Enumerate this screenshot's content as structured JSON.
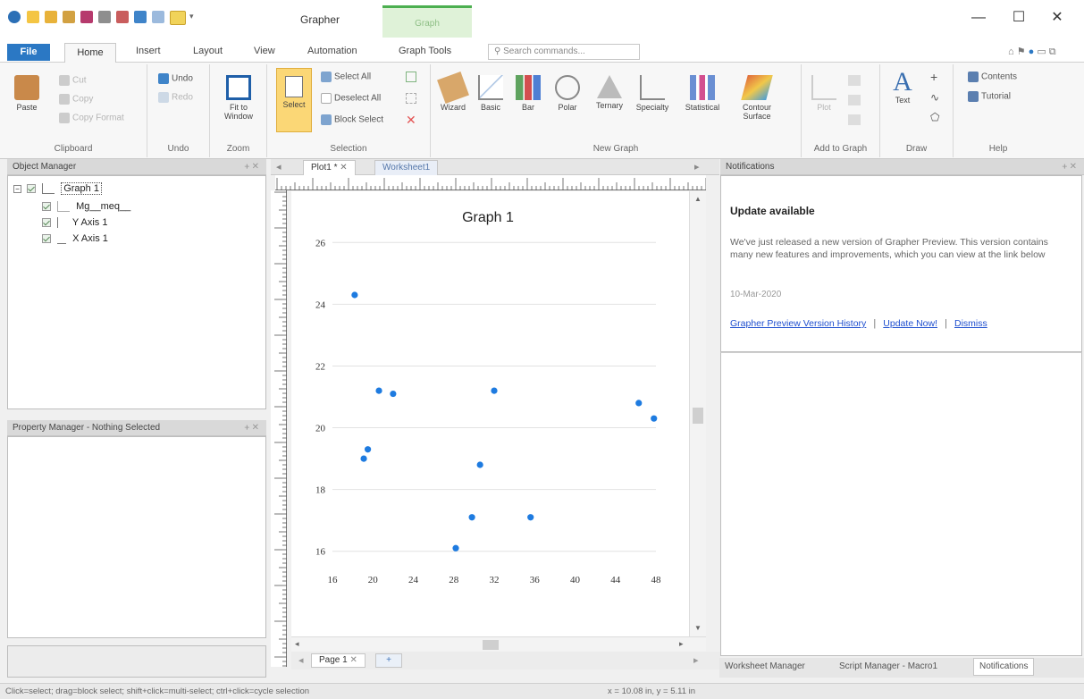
{
  "window": {
    "title": "Grapher",
    "context_tab": "Graph",
    "minimize": "—",
    "maximize": "☐",
    "close": "✕"
  },
  "ribbon_tabs": [
    "File",
    "Home",
    "Insert",
    "Layout",
    "View",
    "Automation",
    "Graph Tools"
  ],
  "search": {
    "placeholder": "Search commands..."
  },
  "ribbon": {
    "clipboard": {
      "label": "Clipboard",
      "paste": "Paste",
      "cut": "Cut",
      "copy": "Copy",
      "copy_format": "Copy Format"
    },
    "undo": {
      "label": "Undo",
      "undo": "Undo",
      "redo": "Redo"
    },
    "zoom": {
      "label": "Zoom",
      "fit": "Fit to Window"
    },
    "selection": {
      "label": "Selection",
      "select": "Select",
      "select_all": "Select All",
      "deselect_all": "Deselect All",
      "block_select": "Block Select"
    },
    "new_graph": {
      "label": "New Graph",
      "items": [
        "Wizard",
        "Basic",
        "Bar",
        "Polar",
        "Ternary",
        "Specialty",
        "Statistical",
        "Contour Surface"
      ]
    },
    "add_to_graph": {
      "label": "Add to Graph",
      "plot": "Plot"
    },
    "draw": {
      "label": "Draw",
      "text": "Text"
    },
    "help": {
      "label": "Help",
      "contents": "Contents",
      "tutorial": "Tutorial"
    }
  },
  "object_manager": {
    "title": "Object Manager",
    "items": [
      "Graph 1",
      "Mg__meq__",
      "Y Axis 1",
      "X Axis 1"
    ]
  },
  "property_manager": {
    "title": "Property Manager - Nothing Selected"
  },
  "doc_tabs": [
    "Plot1 *",
    "Worksheet1"
  ],
  "page_tab": "Page 1",
  "notifications": {
    "panel_title": "Notifications",
    "title": "Update available",
    "body": "We've just released a new version of Grapher Preview. This version contains many new features and improvements, which you can view at the link below",
    "date": "10-Mar-2020",
    "link_history": "Grapher Preview Version History",
    "link_update": "Update Now!",
    "link_dismiss": "Dismiss",
    "sep": "|"
  },
  "bottom_tabs": [
    "Worksheet Manager",
    "Script Manager - Macro1",
    "Notifications"
  ],
  "status": {
    "hint": "Click=select; drag=block select; shift+click=multi-select; ctrl+click=cycle selection",
    "coords": "x = 10.08 in, y = 5.11 in"
  },
  "colors": {
    "accent": "#2b78c4",
    "point": "#1e7be0",
    "context": "#4caf50"
  },
  "chart_data": {
    "type": "scatter",
    "title": "Graph 1",
    "xlim": [
      16,
      48
    ],
    "ylim": [
      15.5,
      26.5
    ],
    "xticks": [
      16,
      20,
      24,
      28,
      32,
      36,
      40,
      44,
      48
    ],
    "yticks": [
      16,
      18,
      20,
      22,
      24,
      26
    ],
    "grid": true,
    "points": [
      [
        18.2,
        24.3
      ],
      [
        19.1,
        19.0
      ],
      [
        19.5,
        19.3
      ],
      [
        20.6,
        21.2
      ],
      [
        22.0,
        21.1
      ],
      [
        28.2,
        16.1
      ],
      [
        29.8,
        17.1
      ],
      [
        30.6,
        18.8
      ],
      [
        32.0,
        21.2
      ],
      [
        35.6,
        17.1
      ],
      [
        46.3,
        20.8
      ],
      [
        47.8,
        20.3
      ]
    ]
  }
}
